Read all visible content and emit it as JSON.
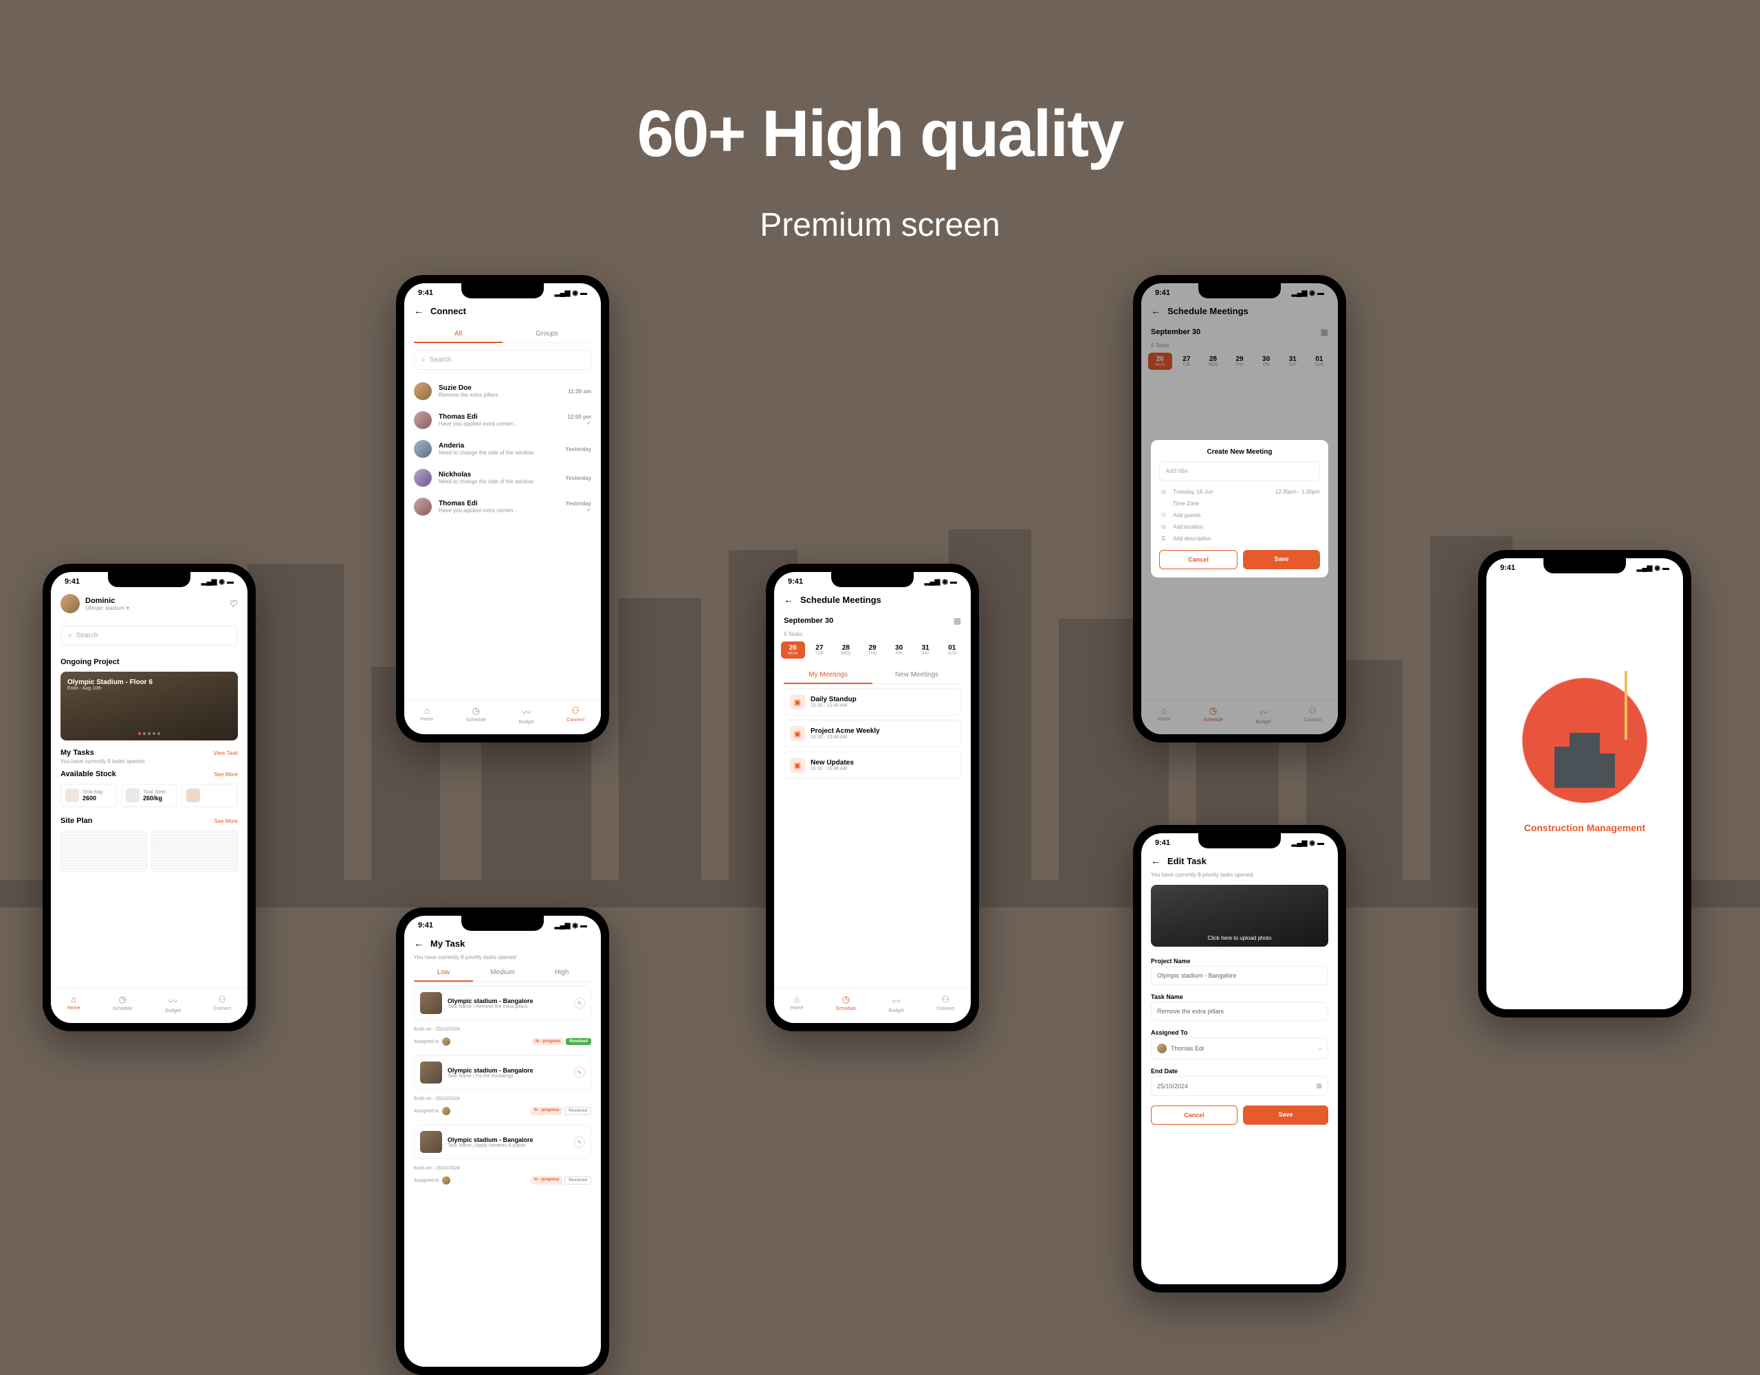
{
  "hero": {
    "title": "60+ High quality",
    "subtitle": "Premium screen"
  },
  "status": {
    "time": "9:41"
  },
  "nav": {
    "home": "Home",
    "schedule": "Schedule",
    "budget": "Budget",
    "connect": "Connect"
  },
  "connect": {
    "title": "Connect",
    "tabs": {
      "all": "All",
      "groups": "Groups"
    },
    "search_ph": "Search",
    "items": [
      {
        "name": "Suzie Doe",
        "msg": "Remove the extra pillars",
        "time": "11:30 am"
      },
      {
        "name": "Thomas Edi",
        "msg": "Have you applied extra cemen...",
        "time": "12:00 pm",
        "sent": true
      },
      {
        "name": "Anderia",
        "msg": "Need to change the side of the window",
        "time": "Yesterday"
      },
      {
        "name": "Nickholas",
        "msg": "Need to change the side of the window",
        "time": "Yesterday"
      },
      {
        "name": "Thomas Edi",
        "msg": "Have you applied extra cemen...",
        "time": "Yesterday",
        "sent": true
      }
    ]
  },
  "home": {
    "user": "Dominic",
    "loc": "Olimpic stadium",
    "search_ph": "Search",
    "ongoing": "Ongoing Project",
    "project": {
      "title": "Olympic Stadium - Floor 6",
      "date": "Ends - Aug 10th"
    },
    "tasks": {
      "title": "My Tasks",
      "link": "View Task",
      "sub": "You have currently 8 tasks opened"
    },
    "stock": {
      "title": "Available Stock",
      "link": "See More",
      "items": [
        {
          "label": "Total Bag",
          "value": "2600"
        },
        {
          "label": "Total Steel",
          "value": "260/kg"
        },
        {
          "label": "",
          "value": ""
        }
      ]
    },
    "siteplan": {
      "title": "Site Plan",
      "link": "See More"
    }
  },
  "schedule": {
    "title": "Schedule Meetings",
    "month": "September 30",
    "count": "6 Tasks",
    "dates": [
      {
        "num": "26",
        "day": "MON",
        "active": true
      },
      {
        "num": "27",
        "day": "TUE"
      },
      {
        "num": "28",
        "day": "WED"
      },
      {
        "num": "29",
        "day": "THU"
      },
      {
        "num": "30",
        "day": "FRI"
      },
      {
        "num": "31",
        "day": "SAT"
      },
      {
        "num": "01",
        "day": "SUN"
      }
    ],
    "tabs": {
      "mine": "My Meetings",
      "new": "New Meetings"
    },
    "meetings": [
      {
        "name": "Daily Standup",
        "time": "10:30 - 10:46 AM"
      },
      {
        "name": "Project Acme Weekly",
        "time": "10:30 - 10:46 AM"
      },
      {
        "name": "New Updates",
        "time": "10:30 - 10:46 AM"
      }
    ]
  },
  "new_meeting": {
    "title": "Create New Meeting",
    "add_title_ph": "Add title",
    "date": "Tuesday, 18 Jun",
    "time": "12:30pm - 1:30pm",
    "tz": "Time Zone",
    "guests": "Add guests",
    "location": "Add location",
    "desc": "Add description",
    "cancel": "Cancel",
    "save": "Save"
  },
  "mytask": {
    "title": "My Task",
    "sub": "You have currently 8 priority tasks opened",
    "filters": {
      "low": "Low",
      "medium": "Medium",
      "high": "High"
    },
    "ends": "Ends on - 25/10/2024",
    "assigned": "Assigned to",
    "tasks": [
      {
        "title": "Olympic stadium - Bangalore",
        "sub_label": "Task Name",
        "sub_val": "Remove the extra pillars",
        "prog": "In - progress",
        "resolved": "Resolved",
        "greenResolved": true
      },
      {
        "title": "Olympic stadium - Bangalore",
        "sub_label": "Task Name",
        "sub_val": "Fix the mouldings",
        "prog": "In - progress",
        "resolved": "Resolved"
      },
      {
        "title": "Olympic stadium - Bangalore",
        "sub_label": "Task Name",
        "sub_val": "Apply cements & paints",
        "prog": "In - progress",
        "resolved": "Resolved"
      }
    ]
  },
  "edit_task": {
    "title": "Edit Task",
    "sub": "You have currently 8 priority tasks opened",
    "upload": "Click here to upload photo",
    "fields": {
      "project_name": {
        "label": "Project Name",
        "value": "Olympic stadium - Bangalore"
      },
      "task_name": {
        "label": "Task Name",
        "value": "Remove the extra pillars"
      },
      "assigned_to": {
        "label": "Assigned To",
        "value": "Thomas Edi"
      },
      "end_date": {
        "label": "End Date",
        "value": "25/10/2024"
      }
    },
    "cancel": "Cancel",
    "save": "Save"
  },
  "splash": {
    "title": "Construction Management"
  }
}
